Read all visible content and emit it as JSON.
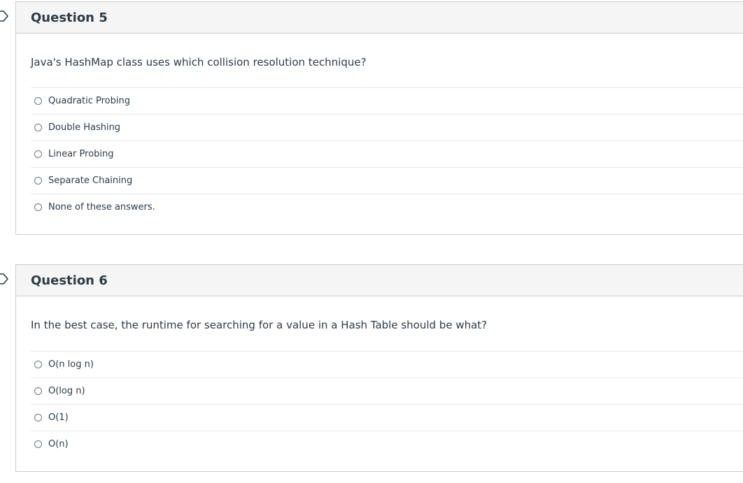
{
  "questions": [
    {
      "title": "Question 5",
      "text": "Java's HashMap class uses which collision resolution technique?",
      "answers": [
        "Quadratic Probing",
        "Double Hashing",
        "Linear Probing",
        "Separate Chaining",
        "None of these answers."
      ]
    },
    {
      "title": "Question 6",
      "text": "In the best case, the runtime for searching for a value in a Hash Table should be what?",
      "answers": [
        "O(n log n)",
        "O(log n)",
        "O(1)",
        "O(n)"
      ]
    }
  ],
  "icons": {
    "bookmark": "bookmark-flag-icon",
    "radio": "radio-unselected-icon"
  },
  "colors": {
    "text": "#2d3b45",
    "header_bg": "#f5f5f5",
    "border": "#c7cdd1",
    "divider": "#e5e8ea"
  }
}
